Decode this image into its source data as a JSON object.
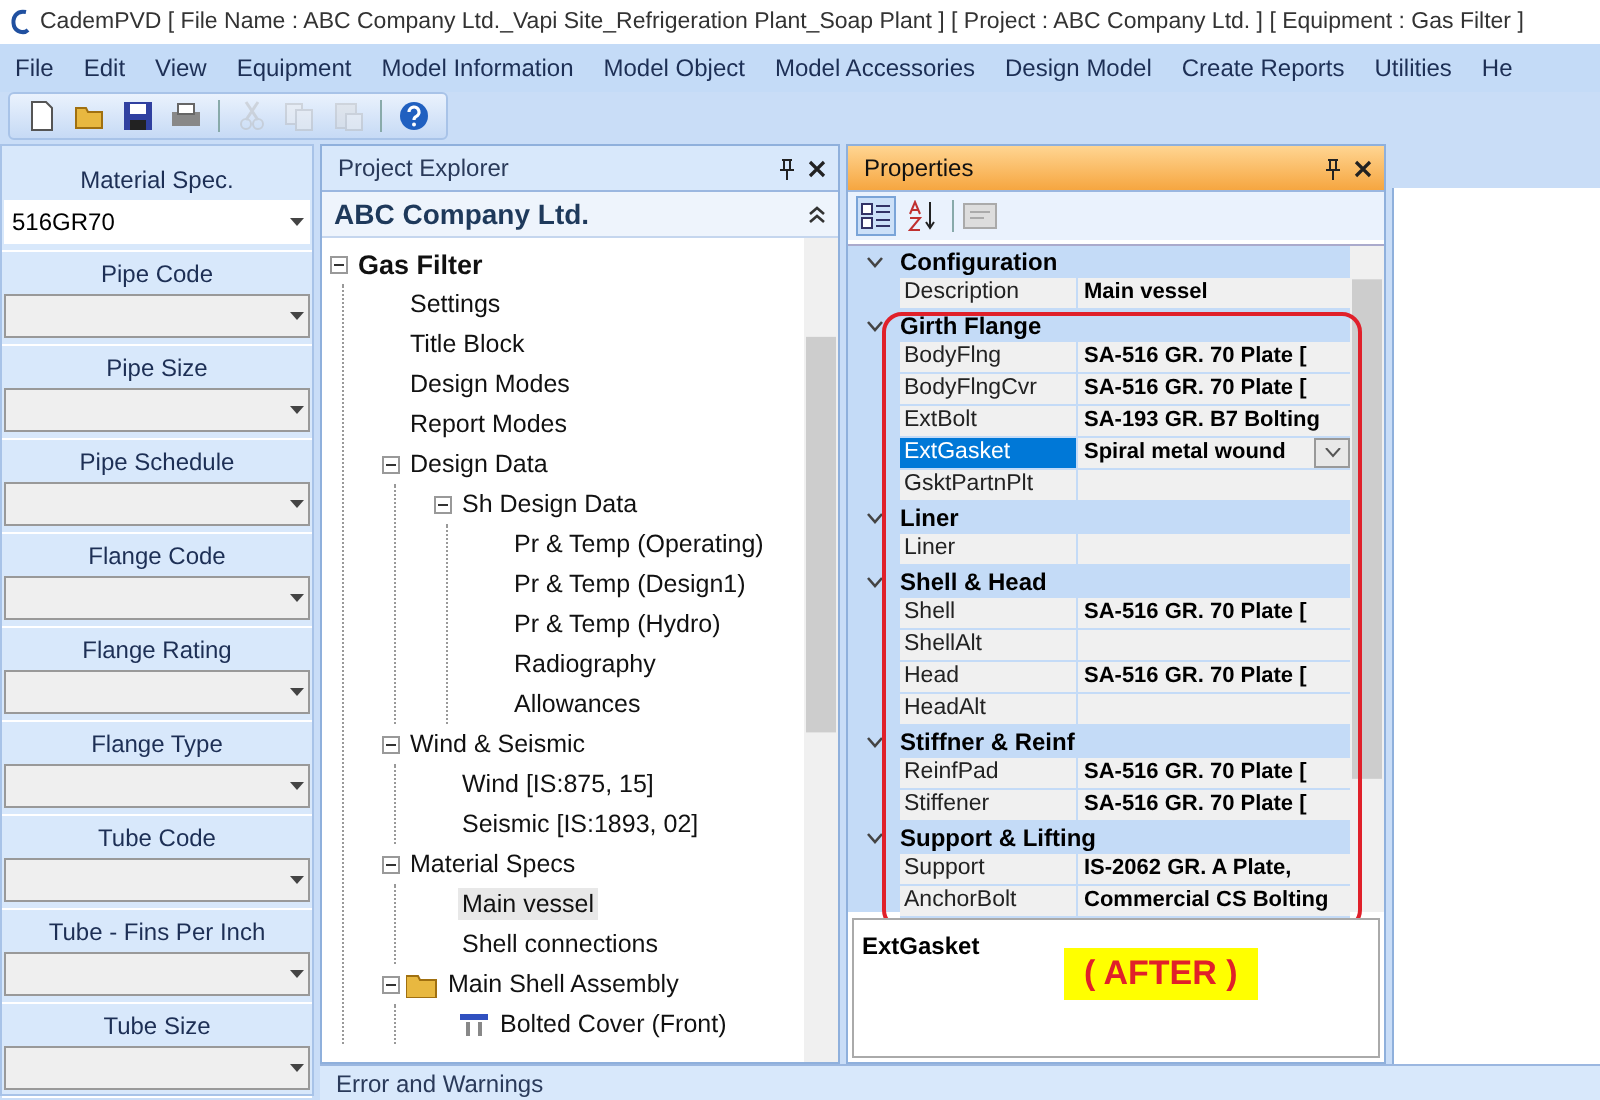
{
  "window": {
    "title": "CademPVD [ File Name : ABC Company Ltd._Vapi Site_Refrigeration Plant_Soap Plant ] [ Project : ABC Company Ltd. ] [ Equipment : Gas Filter ]"
  },
  "menu": [
    "File",
    "Edit",
    "View",
    "Equipment",
    "Model Information",
    "Model Object",
    "Model Accessories",
    "Design Model",
    "Create Reports",
    "Utilities",
    "He"
  ],
  "toolbar": [
    {
      "kind": "new",
      "disabled": false
    },
    {
      "kind": "open",
      "disabled": false
    },
    {
      "kind": "save",
      "disabled": false
    },
    {
      "kind": "print",
      "disabled": false
    },
    {
      "kind": "separator"
    },
    {
      "kind": "cut",
      "disabled": true
    },
    {
      "kind": "copy",
      "disabled": true
    },
    {
      "kind": "paste",
      "disabled": true
    },
    {
      "kind": "separator"
    },
    {
      "kind": "help",
      "disabled": false
    }
  ],
  "spec_panel": {
    "fields": [
      {
        "label": "Material Spec.",
        "value": "516GR70"
      },
      {
        "label": "Pipe Code"
      },
      {
        "label": "Pipe Size"
      },
      {
        "label": "Pipe Schedule"
      },
      {
        "label": "Flange Code"
      },
      {
        "label": "Flange Rating"
      },
      {
        "label": "Flange Type"
      },
      {
        "label": "Tube Code"
      },
      {
        "label": "Tube - Fins Per Inch"
      },
      {
        "label": "Tube Size"
      }
    ]
  },
  "project_explorer": {
    "title": "Project Explorer",
    "header": "ABC Company Ltd.",
    "tree": [
      {
        "label": "Gas Filter",
        "kind": "node",
        "selected": false,
        "expanded": true,
        "children": [
          {
            "label": "Settings",
            "kind": "node",
            "selected": false
          },
          {
            "label": "Title Block",
            "kind": "node",
            "selected": false
          },
          {
            "label": "Design Modes",
            "kind": "node",
            "selected": false
          },
          {
            "label": "Report Modes",
            "kind": "node",
            "selected": false
          },
          {
            "label": "Design Data",
            "kind": "node",
            "selected": false,
            "expanded": true,
            "children": [
              {
                "label": "Sh Design Data",
                "kind": "node",
                "selected": false,
                "expanded": true,
                "children": [
                  {
                    "label": "Pr & Temp (Operating)",
                    "kind": "node",
                    "selected": false
                  },
                  {
                    "label": "Pr & Temp (Design1)",
                    "kind": "node",
                    "selected": false
                  },
                  {
                    "label": "Pr & Temp (Hydro)",
                    "kind": "node",
                    "selected": false
                  },
                  {
                    "label": "Radiography",
                    "kind": "node",
                    "selected": false
                  },
                  {
                    "label": "Allowances",
                    "kind": "node",
                    "selected": false
                  }
                ]
              }
            ]
          },
          {
            "label": "Wind & Seismic",
            "kind": "node",
            "selected": false,
            "expanded": true,
            "children": [
              {
                "label": "Wind [IS:875, 15]",
                "kind": "node",
                "selected": false
              },
              {
                "label": "Seismic [IS:1893, 02]",
                "kind": "node",
                "selected": false
              }
            ]
          },
          {
            "label": "Material Specs",
            "kind": "node",
            "selected": false,
            "expanded": true,
            "children": [
              {
                "label": "Main vessel",
                "kind": "node",
                "selected": true
              },
              {
                "label": "Shell connections",
                "kind": "node",
                "selected": false
              }
            ]
          },
          {
            "label": "Main Shell Assembly",
            "kind": "folder",
            "selected": false,
            "expanded": true,
            "children": [
              {
                "label": "Bolted Cover (Front)",
                "kind": "part",
                "selected": false
              }
            ]
          }
        ]
      }
    ]
  },
  "properties": {
    "title": "Properties",
    "view_buttons": [
      {
        "kind": "categorized",
        "selected": true
      },
      {
        "kind": "alphabetical",
        "selected": false
      }
    ],
    "categories": [
      {
        "name": "Configuration",
        "expanded": true,
        "rows": [
          {
            "name": "Description",
            "value": "Main vessel",
            "selected": false
          }
        ]
      },
      {
        "name": "Girth Flange",
        "expanded": true,
        "rows": [
          {
            "name": "BodyFlng",
            "value": "SA-516 GR. 70 Plate [",
            "selected": false
          },
          {
            "name": "BodyFlngCvr",
            "value": "SA-516 GR. 70 Plate [",
            "selected": false
          },
          {
            "name": "ExtBolt",
            "value": "SA-193 GR. B7 Bolting",
            "selected": false
          },
          {
            "name": "ExtGasket",
            "value": "Spiral metal wound",
            "selected": true
          },
          {
            "name": "GsktPartnPlt",
            "selected": false
          }
        ]
      },
      {
        "name": "Liner",
        "expanded": true,
        "rows": [
          {
            "name": "Liner",
            "selected": false
          }
        ]
      },
      {
        "name": "Shell & Head",
        "expanded": true,
        "rows": [
          {
            "name": "Shell",
            "value": "SA-516 GR. 70 Plate [",
            "selected": false
          },
          {
            "name": "ShellAlt",
            "selected": false
          },
          {
            "name": "Head",
            "value": "SA-516 GR. 70 Plate [",
            "selected": false
          },
          {
            "name": "HeadAlt",
            "selected": false
          }
        ]
      },
      {
        "name": "Stiffner & Reinf",
        "expanded": true,
        "rows": [
          {
            "name": "ReinfPad",
            "value": "SA-516 GR. 70 Plate [",
            "selected": false
          },
          {
            "name": "Stiffener",
            "value": "SA-516 GR. 70 Plate [",
            "selected": false
          }
        ]
      },
      {
        "name": "Support & Lifting",
        "expanded": true,
        "rows": [
          {
            "name": "Support",
            "value": "IS-2062 GR. A Plate,",
            "selected": false
          },
          {
            "name": "AnchorBolt",
            "value": "Commercial CS Bolting",
            "selected": false
          }
        ]
      }
    ],
    "description_title": "ExtGasket",
    "annotation": "( AFTER )"
  },
  "bottom_panel": {
    "title": "Error and Warnings"
  }
}
